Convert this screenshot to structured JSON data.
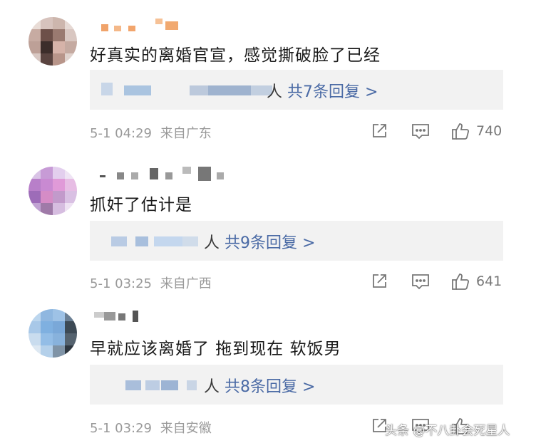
{
  "comments": [
    {
      "text": "好真实的离婚官宣，感觉撕破脸了已经",
      "reply_prefix": "人",
      "reply_count": "共7条回复 >",
      "time": "5-1 04:29",
      "location": "来自广东",
      "likes": "740"
    },
    {
      "text": "抓奸了估计是",
      "reply_prefix": "人",
      "reply_count": "共9条回复 >",
      "time": "5-1 03:25",
      "location": "来自广西",
      "likes": "641"
    },
    {
      "text": "早就应该离婚了 拖到现在 软饭男",
      "reply_prefix": "人",
      "reply_count": "共8条回复 >",
      "time": "5-1 03:29",
      "location": "来自安徽",
      "likes": ""
    }
  ],
  "icons": {
    "share": "share-icon",
    "comment": "comment-icon",
    "like": "thumbs-up-icon"
  },
  "watermark": "头条 @不八卦会死星人"
}
